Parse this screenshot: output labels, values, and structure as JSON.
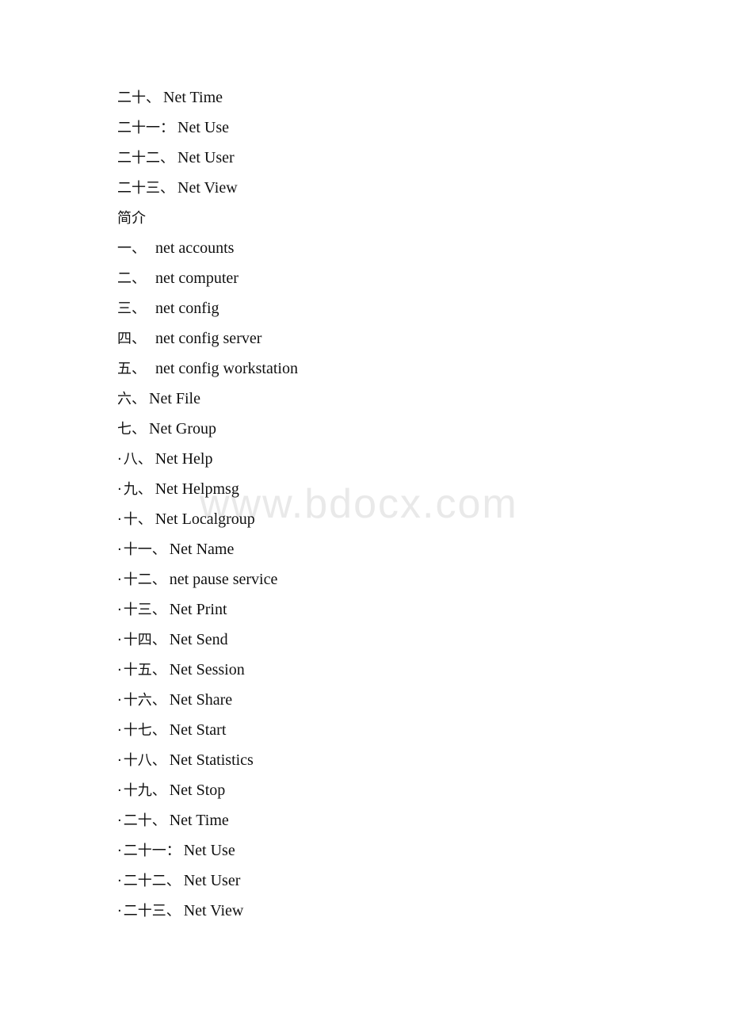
{
  "document": {
    "watermark": "www.bdocx.com",
    "heading": "简介",
    "top_list": [
      {
        "num": "二十、",
        "label": "Net Time",
        "bullet": "",
        "wide_gap": false
      },
      {
        "num": "二十一：",
        "label": "Net Use",
        "bullet": "",
        "wide_gap": false
      },
      {
        "num": "二十二、",
        "label": "Net User",
        "bullet": "",
        "wide_gap": false
      },
      {
        "num": "二十三、",
        "label": "Net View",
        "bullet": "",
        "wide_gap": false
      }
    ],
    "main_list": [
      {
        "num": "一、",
        "label": "net accounts",
        "bullet": "",
        "wide_gap": true
      },
      {
        "num": "二、",
        "label": "net computer",
        "bullet": "",
        "wide_gap": true
      },
      {
        "num": "三、",
        "label": "net config",
        "bullet": "",
        "wide_gap": true
      },
      {
        "num": "四、",
        "label": "net config server",
        "bullet": "",
        "wide_gap": true
      },
      {
        "num": "五、",
        "label": "net config workstation",
        "bullet": "",
        "wide_gap": true
      },
      {
        "num": "六、",
        "label": "Net File",
        "bullet": "",
        "wide_gap": false
      },
      {
        "num": "七、",
        "label": "Net Group",
        "bullet": "",
        "wide_gap": false
      },
      {
        "num": "八、",
        "label": "Net Help",
        "bullet": "·",
        "wide_gap": false
      },
      {
        "num": "九、",
        "label": "Net Helpmsg",
        "bullet": "·",
        "wide_gap": false
      },
      {
        "num": "十、",
        "label": "Net Localgroup",
        "bullet": "·",
        "wide_gap": false
      },
      {
        "num": "十一、",
        "label": "Net Name",
        "bullet": "·",
        "wide_gap": false
      },
      {
        "num": "十二、",
        "label": "net pause service",
        "bullet": "·",
        "wide_gap": false
      },
      {
        "num": "十三、",
        "label": "Net Print",
        "bullet": "·",
        "wide_gap": false
      },
      {
        "num": "十四、",
        "label": "Net Send",
        "bullet": "·",
        "wide_gap": false
      },
      {
        "num": "十五、",
        "label": "Net Session",
        "bullet": "·",
        "wide_gap": false
      },
      {
        "num": "十六、",
        "label": "Net Share",
        "bullet": "·",
        "wide_gap": false
      },
      {
        "num": "十七、",
        "label": "Net Start",
        "bullet": "·",
        "wide_gap": false
      },
      {
        "num": "十八、",
        "label": "Net Statistics",
        "bullet": "·",
        "wide_gap": false
      },
      {
        "num": "十九、",
        "label": "Net Stop",
        "bullet": "·",
        "wide_gap": false
      },
      {
        "num": "二十、",
        "label": "Net Time",
        "bullet": "·",
        "wide_gap": false
      },
      {
        "num": "二十一：",
        "label": "Net Use",
        "bullet": "·",
        "wide_gap": false
      },
      {
        "num": "二十二、",
        "label": "Net User",
        "bullet": "·",
        "wide_gap": false
      },
      {
        "num": "二十三、",
        "label": "Net View",
        "bullet": "·",
        "wide_gap": false
      }
    ]
  }
}
